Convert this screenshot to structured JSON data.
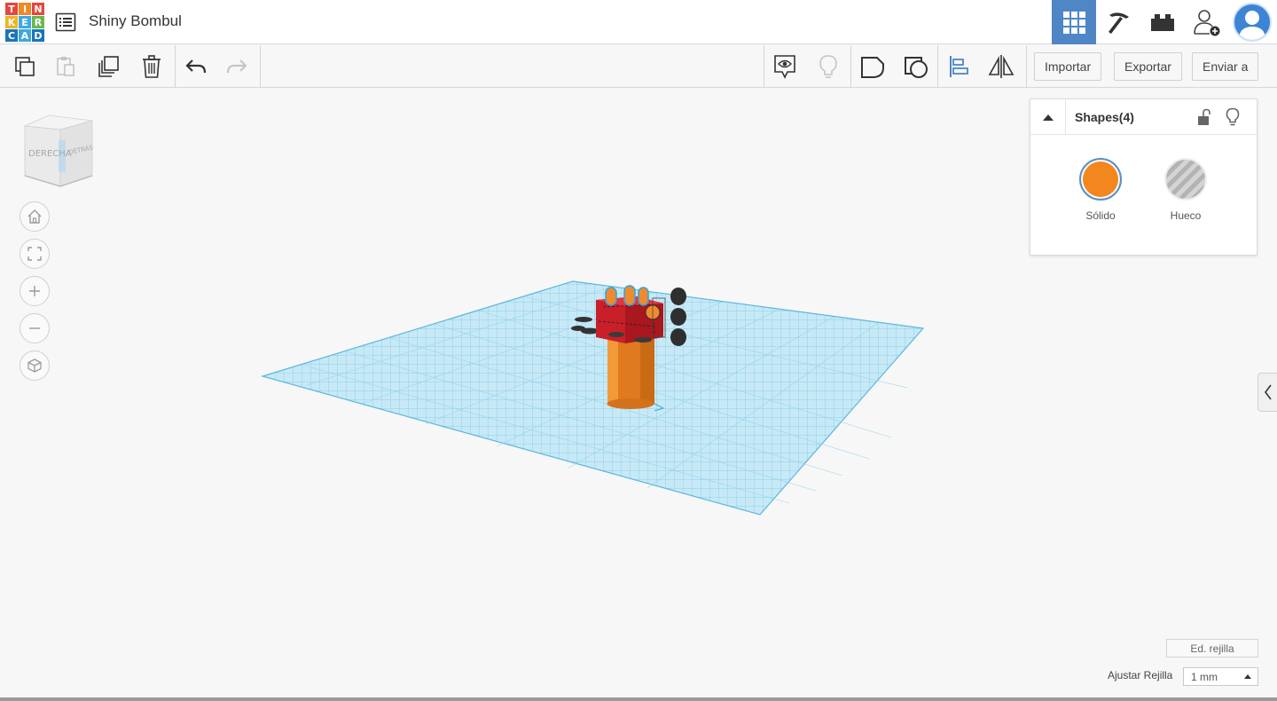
{
  "header": {
    "logo_letters": [
      "T",
      "I",
      "N",
      "K",
      "E",
      "R",
      "C",
      "A",
      "D"
    ],
    "design_title": "Shiny Bombul"
  },
  "toolbar": {
    "import_label": "Importar",
    "export_label": "Exportar",
    "send_label": "Enviar a"
  },
  "viewcube": {
    "face_right": "DERECHA",
    "face_back": "DETRÁS"
  },
  "inspector": {
    "title": "Shapes(4)",
    "solid_label": "Sólido",
    "hole_label": "Hueco"
  },
  "grid": {
    "edit_label": "Ed. rejilla",
    "snap_label": "Ajustar Rejilla",
    "snap_value": "1 mm"
  },
  "colors": {
    "accent": "#4f86c6",
    "solid_orange": "#f2871f",
    "workplane": "#bfe6f5",
    "shape_red": "#d9232c"
  }
}
